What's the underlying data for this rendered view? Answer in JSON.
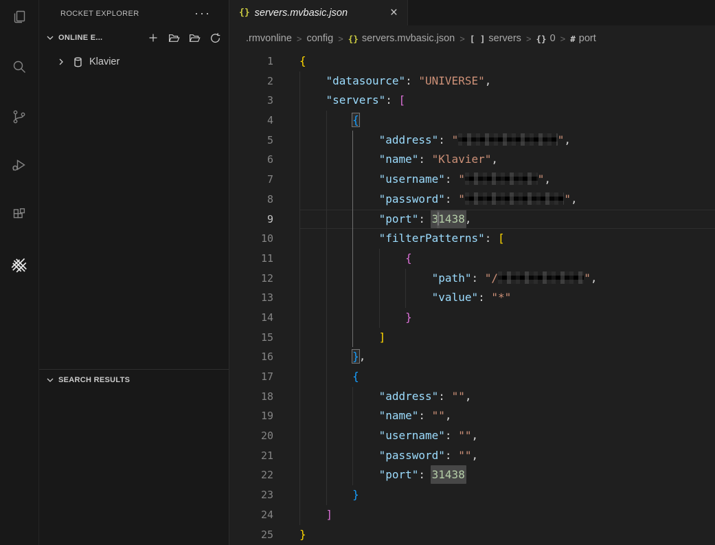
{
  "theme": {
    "editor_bg": "#1f1f1f",
    "panel_bg": "#181818",
    "key_color": "#9cdcfe",
    "string_color": "#ce9178",
    "number_color": "#b5cea8",
    "bracket1": "#ffd700",
    "bracket2": "#da70d6",
    "bracket3": "#179fff",
    "word_highlight": "#575757",
    "cursor": "#c8c8c8",
    "line_number": "#858585",
    "active_line_number": "#c6c6c6",
    "json_file_icon": "#cbcb41",
    "breadcrumb_text": "#a9a9a9"
  },
  "activity_bar": {
    "icons": [
      "files-icon",
      "search-icon",
      "source-control-icon",
      "run-debug-icon",
      "extensions-icon",
      "rocket-icon"
    ],
    "active_icon": "rocket-icon"
  },
  "sidebar": {
    "title": "ROCKET EXPLORER",
    "more_icon_text": "···",
    "sections": [
      {
        "label": "ONLINE E...",
        "actions": [
          "add-icon",
          "open-folder-icon",
          "open-folder-icon",
          "refresh-icon"
        ]
      },
      {
        "label": "SEARCH RESULTS"
      }
    ],
    "tree_items": [
      {
        "label": "Klavier",
        "icon": "database-icon"
      }
    ]
  },
  "editor": {
    "tab": {
      "icon_text": "{}",
      "label": "servers.mvbasic.json",
      "close_icon": "×"
    },
    "breadcrumbs": {
      "separator": ">",
      "items": [
        {
          "label": ".rmvonline",
          "icon_text": ""
        },
        {
          "label": "config",
          "icon_text": ""
        },
        {
          "label": "servers.mvbasic.json",
          "icon_text": "{}"
        },
        {
          "label": "servers",
          "icon_text": "[ ]"
        },
        {
          "label": "0",
          "icon_text": "{}"
        },
        {
          "label": "port",
          "icon_text": "#"
        }
      ]
    },
    "code": {
      "lines": [
        {
          "n": 1,
          "indent": 0,
          "tokens": [
            {
              "c": "b1",
              "t": "{"
            }
          ]
        },
        {
          "n": 2,
          "indent": 4,
          "tokens": [
            {
              "c": "key",
              "t": "\"datasource\""
            },
            {
              "c": "pun",
              "t": ": "
            },
            {
              "c": "str",
              "t": "\"UNIVERSE\""
            },
            {
              "c": "pun",
              "t": ","
            }
          ]
        },
        {
          "n": 3,
          "indent": 4,
          "tokens": [
            {
              "c": "key",
              "t": "\"servers\""
            },
            {
              "c": "pun",
              "t": ": "
            },
            {
              "c": "b2",
              "t": "["
            }
          ]
        },
        {
          "n": 4,
          "indent": 8,
          "tokens": [
            {
              "c": "b3 match",
              "t": "{"
            }
          ]
        },
        {
          "n": 5,
          "indent": 12,
          "ag": 2,
          "tokens": [
            {
              "c": "key",
              "t": "\"address\""
            },
            {
              "c": "pun",
              "t": ": "
            },
            {
              "c": "str",
              "t": "\""
            },
            {
              "c": "redact",
              "w": 15
            },
            {
              "c": "str",
              "t": "\""
            },
            {
              "c": "pun",
              "t": ","
            }
          ]
        },
        {
          "n": 6,
          "indent": 12,
          "ag": 2,
          "tokens": [
            {
              "c": "key",
              "t": "\"name\""
            },
            {
              "c": "pun",
              "t": ": "
            },
            {
              "c": "str",
              "t": "\"Klavier\""
            },
            {
              "c": "pun",
              "t": ","
            }
          ]
        },
        {
          "n": 7,
          "indent": 12,
          "ag": 2,
          "tokens": [
            {
              "c": "key",
              "t": "\"username\""
            },
            {
              "c": "pun",
              "t": ": "
            },
            {
              "c": "str",
              "t": "\""
            },
            {
              "c": "redact",
              "w": 11
            },
            {
              "c": "str",
              "t": "\""
            },
            {
              "c": "pun",
              "t": ","
            }
          ]
        },
        {
          "n": 8,
          "indent": 12,
          "ag": 2,
          "tokens": [
            {
              "c": "key",
              "t": "\"password\""
            },
            {
              "c": "pun",
              "t": ": "
            },
            {
              "c": "str",
              "t": "\""
            },
            {
              "c": "redact",
              "w": 15
            },
            {
              "c": "str",
              "t": "\""
            },
            {
              "c": "pun",
              "t": ","
            }
          ]
        },
        {
          "n": 9,
          "indent": 12,
          "ag": 2,
          "cur": true,
          "tokens": [
            {
              "c": "key",
              "t": "\"port\""
            },
            {
              "c": "pun",
              "t": ": "
            },
            {
              "c": "num hl",
              "t": "3"
            },
            {
              "c": "cursor"
            },
            {
              "c": "num hl",
              "t": "1438"
            },
            {
              "c": "pun",
              "t": ","
            }
          ]
        },
        {
          "n": 10,
          "indent": 12,
          "ag": 2,
          "tokens": [
            {
              "c": "key",
              "t": "\"filterPatterns\""
            },
            {
              "c": "pun",
              "t": ": "
            },
            {
              "c": "b1",
              "t": "["
            }
          ]
        },
        {
          "n": 11,
          "indent": 16,
          "ag": 2,
          "tokens": [
            {
              "c": "b2",
              "t": "{"
            }
          ]
        },
        {
          "n": 12,
          "indent": 20,
          "ag": 2,
          "tokens": [
            {
              "c": "key",
              "t": "\"path\""
            },
            {
              "c": "pun",
              "t": ": "
            },
            {
              "c": "str",
              "t": "\"/"
            },
            {
              "c": "redact",
              "w": 13
            },
            {
              "c": "str",
              "t": "\""
            },
            {
              "c": "pun",
              "t": ","
            }
          ]
        },
        {
          "n": 13,
          "indent": 20,
          "ag": 2,
          "tokens": [
            {
              "c": "key",
              "t": "\"value\""
            },
            {
              "c": "pun",
              "t": ": "
            },
            {
              "c": "str",
              "t": "\"*\""
            }
          ]
        },
        {
          "n": 14,
          "indent": 16,
          "ag": 2,
          "tokens": [
            {
              "c": "b2",
              "t": "}"
            }
          ]
        },
        {
          "n": 15,
          "indent": 12,
          "ag": 2,
          "tokens": [
            {
              "c": "b1",
              "t": "]"
            }
          ]
        },
        {
          "n": 16,
          "indent": 8,
          "tokens": [
            {
              "c": "b3 match",
              "t": "}"
            },
            {
              "c": "pun",
              "t": ","
            }
          ]
        },
        {
          "n": 17,
          "indent": 8,
          "tokens": [
            {
              "c": "b3",
              "t": "{"
            }
          ]
        },
        {
          "n": 18,
          "indent": 12,
          "tokens": [
            {
              "c": "key",
              "t": "\"address\""
            },
            {
              "c": "pun",
              "t": ": "
            },
            {
              "c": "str",
              "t": "\"\""
            },
            {
              "c": "pun",
              "t": ","
            }
          ]
        },
        {
          "n": 19,
          "indent": 12,
          "tokens": [
            {
              "c": "key",
              "t": "\"name\""
            },
            {
              "c": "pun",
              "t": ": "
            },
            {
              "c": "str",
              "t": "\"\""
            },
            {
              "c": "pun",
              "t": ","
            }
          ]
        },
        {
          "n": 20,
          "indent": 12,
          "tokens": [
            {
              "c": "key",
              "t": "\"username\""
            },
            {
              "c": "pun",
              "t": ": "
            },
            {
              "c": "str",
              "t": "\"\""
            },
            {
              "c": "pun",
              "t": ","
            }
          ]
        },
        {
          "n": 21,
          "indent": 12,
          "tokens": [
            {
              "c": "key",
              "t": "\"password\""
            },
            {
              "c": "pun",
              "t": ": "
            },
            {
              "c": "str",
              "t": "\"\""
            },
            {
              "c": "pun",
              "t": ","
            }
          ]
        },
        {
          "n": 22,
          "indent": 12,
          "tokens": [
            {
              "c": "key",
              "t": "\"port\""
            },
            {
              "c": "pun",
              "t": ": "
            },
            {
              "c": "num hl",
              "t": "31438"
            }
          ]
        },
        {
          "n": 23,
          "indent": 8,
          "tokens": [
            {
              "c": "b3",
              "t": "}"
            }
          ]
        },
        {
          "n": 24,
          "indent": 4,
          "tokens": [
            {
              "c": "b2",
              "t": "]"
            }
          ]
        },
        {
          "n": 25,
          "indent": 0,
          "tokens": [
            {
              "c": "b1",
              "t": "}"
            }
          ]
        }
      ]
    }
  }
}
